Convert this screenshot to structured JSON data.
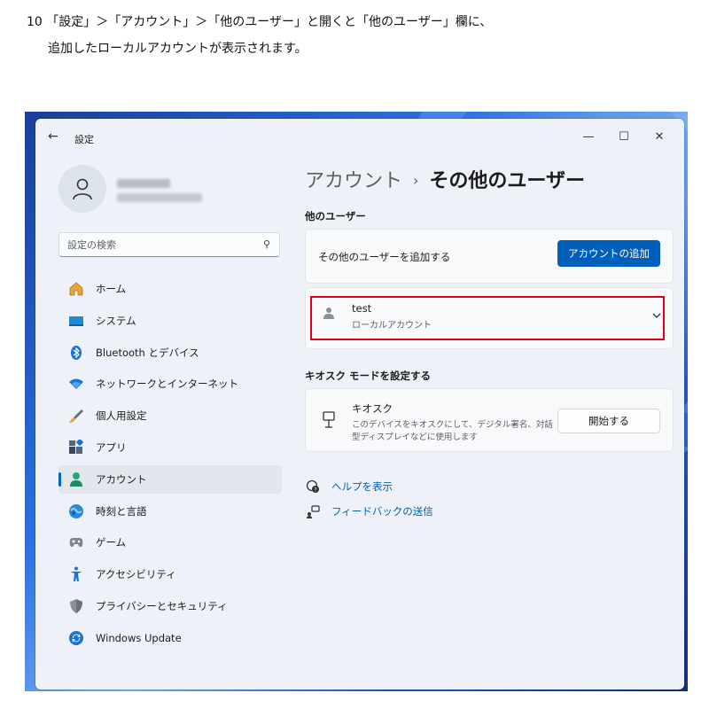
{
  "instruction": {
    "line1": "10 「設定」＞「アカウント」＞「他のユーザー」と開くと「他のユーザー」欄に、",
    "line2": "追加したローカルアカウントが表示されます。"
  },
  "window": {
    "title": "設定",
    "back_icon": "←",
    "minimize_icon": "—",
    "maximize_icon": "☐",
    "close_icon": "✕"
  },
  "sidebar": {
    "search_placeholder": "設定の検索",
    "search_icon": "⚲",
    "items": [
      {
        "label": "ホーム",
        "icon": "home-icon"
      },
      {
        "label": "システム",
        "icon": "system-icon"
      },
      {
        "label": "Bluetooth とデバイス",
        "icon": "bluetooth-icon"
      },
      {
        "label": "ネットワークとインターネット",
        "icon": "wifi-icon"
      },
      {
        "label": "個人用設定",
        "icon": "brush-icon"
      },
      {
        "label": "アプリ",
        "icon": "apps-icon"
      },
      {
        "label": "アカウント",
        "icon": "account-icon",
        "active": true
      },
      {
        "label": "時刻と言語",
        "icon": "globe-icon"
      },
      {
        "label": "ゲーム",
        "icon": "gamepad-icon"
      },
      {
        "label": "アクセシビリティ",
        "icon": "accessibility-icon"
      },
      {
        "label": "プライバシーとセキュリティ",
        "icon": "shield-icon"
      },
      {
        "label": "Windows Update",
        "icon": "update-icon"
      }
    ]
  },
  "main": {
    "breadcrumb": {
      "parent": "アカウント",
      "separator": "›",
      "current": "その他のユーザー"
    },
    "other_users": {
      "heading": "他のユーザー",
      "add_text": "その他のユーザーを追加する",
      "add_button": "アカウントの追加",
      "user": {
        "name": "test",
        "type": "ローカルアカウント"
      }
    },
    "kiosk": {
      "heading": "キオスク モードを設定する",
      "title": "キオスク",
      "desc_line1": "このデバイスをキオスクにして、デジタル署名、対話",
      "desc_line2": "型ディスプレイなどに使用します",
      "button": "開始する"
    },
    "links": {
      "help": "ヘルプを表示",
      "feedback": "フィードバックの送信"
    }
  },
  "colors": {
    "accent": "#005fb8",
    "highlight": "#e0001a"
  }
}
